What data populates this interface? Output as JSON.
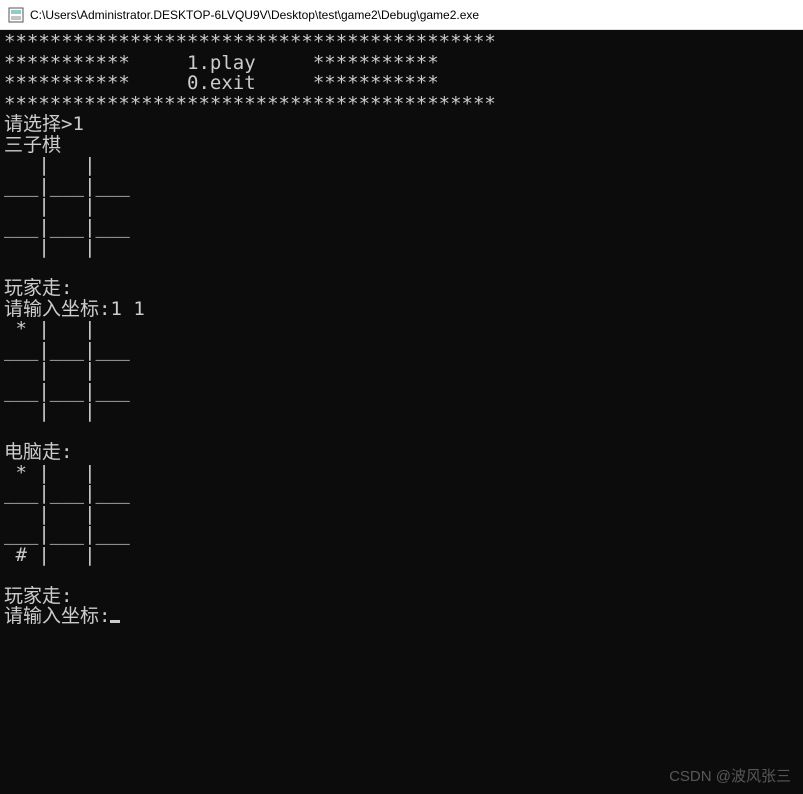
{
  "window": {
    "title": "C:\\Users\\Administrator.DESKTOP-6LVQU9V\\Desktop\\test\\game2\\Debug\\game2.exe"
  },
  "console": {
    "menu_top": "*******************************************",
    "menu_play": "***********     1.play     ***********",
    "menu_exit": "***********     0.exit     ***********",
    "menu_bottom": "*******************************************",
    "prompt_select": "请选择>1",
    "game_title": "三子棋",
    "board_cell_row": "   |   |   ",
    "board_sep_row": "___|___|___",
    "board_row_star": " * |   |   ",
    "board_row_hash": " # |   |   ",
    "player_turn": "玩家走:",
    "input_coord_first": "请输入坐标:1 1",
    "computer_turn": "电脑走:",
    "input_coord_prompt": "请输入坐标:"
  },
  "watermark": "CSDN @波风张三"
}
